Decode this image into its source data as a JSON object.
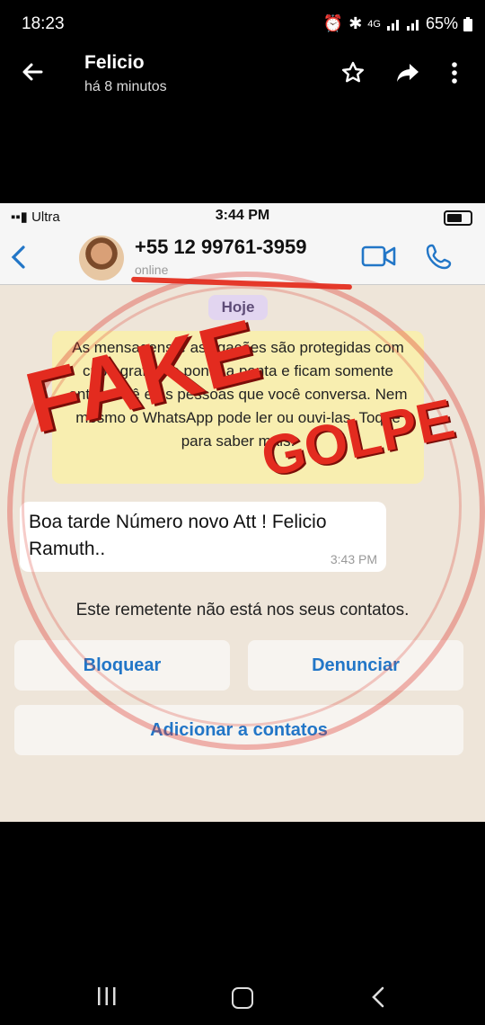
{
  "status_bar": {
    "time": "18:23",
    "network": "4G",
    "battery": "65%"
  },
  "viewer": {
    "title": "Felicio",
    "subtitle": "há 8 minutos"
  },
  "screenshot": {
    "carrier": "Ultra",
    "ios_time": "3:44 PM",
    "contact_phone": "+55 12 99761-3959",
    "contact_status": "online",
    "date_label": "Hoje",
    "encryption_notice": "As mensagens e as ligações são protegidas com criptografia de ponta a ponta e ficam somente entre você e as pessoas que você conversa. Nem mesmo o WhatsApp pode ler ou ouvi-las. Toque para saber mais.",
    "message": {
      "text": "Boa tarde Número novo Att ! Felicio Ramuth..",
      "time": "3:43 PM"
    },
    "not_in_contacts": "Este remetente não está nos seus contatos.",
    "block_label": "Bloquear",
    "report_label": "Denunciar",
    "add_contact_label": "Adicionar a contatos",
    "overlay_fake": "FAKE",
    "overlay_golpe": "GOLPE"
  },
  "colors": {
    "stamp_red": "#e32b1f",
    "ios_blue": "#2276c7"
  },
  "icons": [
    "back-arrow-icon",
    "star-icon",
    "forward-icon",
    "more-vert-icon",
    "video-call-icon",
    "phone-icon",
    "recent-apps-icon",
    "home-icon",
    "nav-back-icon"
  ]
}
